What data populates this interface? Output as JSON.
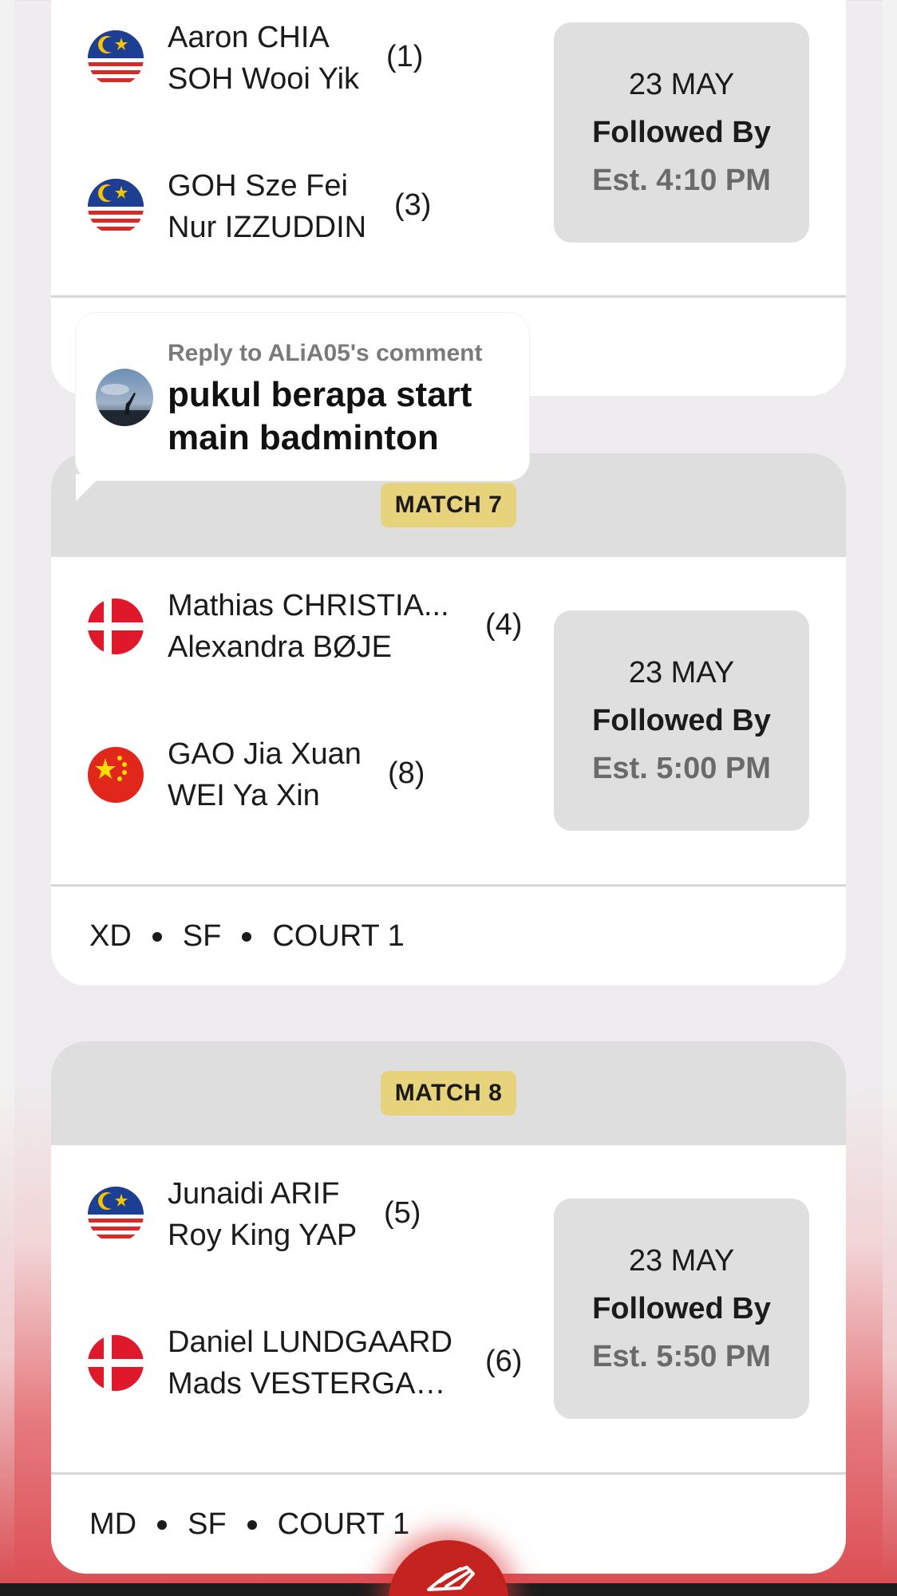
{
  "matches": [
    {
      "id": "prev",
      "badge": "",
      "teams": [
        {
          "flag": "malaysia",
          "players": [
            "Aaron CHIA",
            "SOH Wooi Yik"
          ],
          "seed": "(1)"
        },
        {
          "flag": "malaysia",
          "players": [
            "GOH Sze Fei",
            "Nur IZZUDDIN"
          ],
          "seed": "(3)"
        }
      ],
      "schedule": {
        "date": "23 MAY",
        "followed": "Followed By",
        "est": "Est. 4:10 PM"
      },
      "footer": {
        "event": "",
        "round": "",
        "court": ""
      }
    },
    {
      "id": "match7",
      "badge": "MATCH 7",
      "teams": [
        {
          "flag": "denmark",
          "players": [
            "Mathias CHRISTIA...",
            "Alexandra BØJE"
          ],
          "seed": "(4)"
        },
        {
          "flag": "china",
          "players": [
            "GAO Jia Xuan",
            "WEI Ya Xin"
          ],
          "seed": "(8)"
        }
      ],
      "schedule": {
        "date": "23 MAY",
        "followed": "Followed By",
        "est": "Est. 5:00 PM"
      },
      "footer": {
        "event": "XD",
        "round": "SF",
        "court": "COURT 1"
      }
    },
    {
      "id": "match8",
      "badge": "MATCH 8",
      "teams": [
        {
          "flag": "malaysia",
          "players": [
            "Junaidi ARIF",
            "Roy King YAP"
          ],
          "seed": "(5)"
        },
        {
          "flag": "denmark",
          "players": [
            "Daniel LUNDGAARD",
            "Mads VESTERGAA..."
          ],
          "seed": "(6)"
        }
      ],
      "schedule": {
        "date": "23 MAY",
        "followed": "Followed By",
        "est": "Est. 5:50 PM"
      },
      "footer": {
        "event": "MD",
        "round": "SF",
        "court": "COURT 1"
      }
    }
  ],
  "reply": {
    "meta": "Reply to ALiA05's comment",
    "text": "pukul berapa start main badminton"
  },
  "colors": {
    "badge": "#e6d37c",
    "header": "#dedede",
    "time_box": "#dfdfdf",
    "fab": "#c5231f",
    "est_text": "#6a6a6a"
  },
  "icons": {
    "fab": "shuttlecock-icon",
    "avatar": "avatar"
  }
}
